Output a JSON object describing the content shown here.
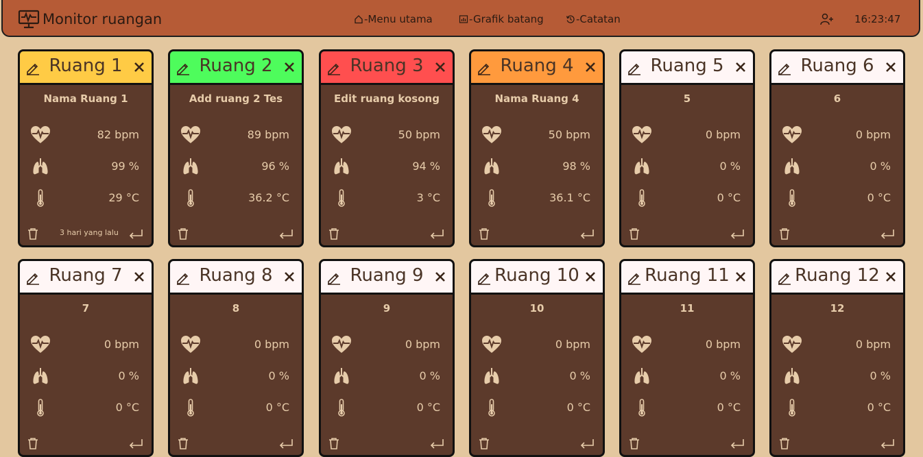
{
  "navbar": {
    "brand_title": "Monitor ruangan",
    "links": [
      "-Menu utama",
      "-Grafik batang",
      "-Catatan"
    ],
    "clock": "16:23:47",
    "bg_color": "#b65b36"
  },
  "colors": {
    "page_bg": "#e3c79f",
    "card_bg": "#5c3a2b",
    "text_light": "#e7ccaa",
    "status_yellow": "#ffcb45",
    "status_green": "#4efc5c",
    "status_red": "#ff4f4f",
    "status_orange": "#ff9a3d",
    "status_idle": "#fff6f6"
  },
  "icons": {
    "brand": "monitor-heartbeat-icon",
    "menu": "home-icon",
    "chart": "bar-chart-icon",
    "notes": "history-icon",
    "add_user": "user-plus-icon",
    "edit": "pencil-icon",
    "close": "close-icon",
    "heart": "heart-rate-icon",
    "lungs": "lungs-icon",
    "temp": "thermometer-icon",
    "delete": "trash-icon",
    "enter": "return-icon"
  },
  "rooms": [
    {
      "title": "Ruang 1",
      "name": "Nama Ruang 1",
      "bpm": "82 bpm",
      "spo2": "99 %",
      "temp": "29 °C",
      "ago": "3 hari yang lalu",
      "color": "#ffcb45"
    },
    {
      "title": "Ruang 2",
      "name": "Add ruang 2 Tes",
      "bpm": "89 bpm",
      "spo2": "96 %",
      "temp": "36.2 °C",
      "ago": "",
      "color": "#4efc5c"
    },
    {
      "title": "Ruang 3",
      "name": "Edit ruang kosong",
      "bpm": "50 bpm",
      "spo2": "94 %",
      "temp": "3 °C",
      "ago": "",
      "color": "#ff4f4f"
    },
    {
      "title": "Ruang 4",
      "name": "Nama Ruang 4",
      "bpm": "50 bpm",
      "spo2": "98 %",
      "temp": "36.1 °C",
      "ago": "",
      "color": "#ff9a3d"
    },
    {
      "title": "Ruang 5",
      "name": "5",
      "bpm": "0 bpm",
      "spo2": "0 %",
      "temp": "0 °C",
      "ago": "",
      "color": "#fff6f6"
    },
    {
      "title": "Ruang 6",
      "name": "6",
      "bpm": "0 bpm",
      "spo2": "0 %",
      "temp": "0 °C",
      "ago": "",
      "color": "#fff6f6"
    },
    {
      "title": "Ruang 7",
      "name": "7",
      "bpm": "0 bpm",
      "spo2": "0 %",
      "temp": "0 °C",
      "ago": "",
      "color": "#fff6f6"
    },
    {
      "title": "Ruang 8",
      "name": "8",
      "bpm": "0 bpm",
      "spo2": "0 %",
      "temp": "0 °C",
      "ago": "",
      "color": "#fff6f6"
    },
    {
      "title": "Ruang 9",
      "name": "9",
      "bpm": "0 bpm",
      "spo2": "0 %",
      "temp": "0 °C",
      "ago": "",
      "color": "#fff6f6"
    },
    {
      "title": "Ruang 10",
      "name": "10",
      "bpm": "0 bpm",
      "spo2": "0 %",
      "temp": "0 °C",
      "ago": "",
      "color": "#fff6f6"
    },
    {
      "title": "Ruang 11",
      "name": "11",
      "bpm": "0 bpm",
      "spo2": "0 %",
      "temp": "0 °C",
      "ago": "",
      "color": "#fff6f6"
    },
    {
      "title": "Ruang 12",
      "name": "12",
      "bpm": "0 bpm",
      "spo2": "0 %",
      "temp": "0 °C",
      "ago": "",
      "color": "#fff6f6"
    }
  ]
}
